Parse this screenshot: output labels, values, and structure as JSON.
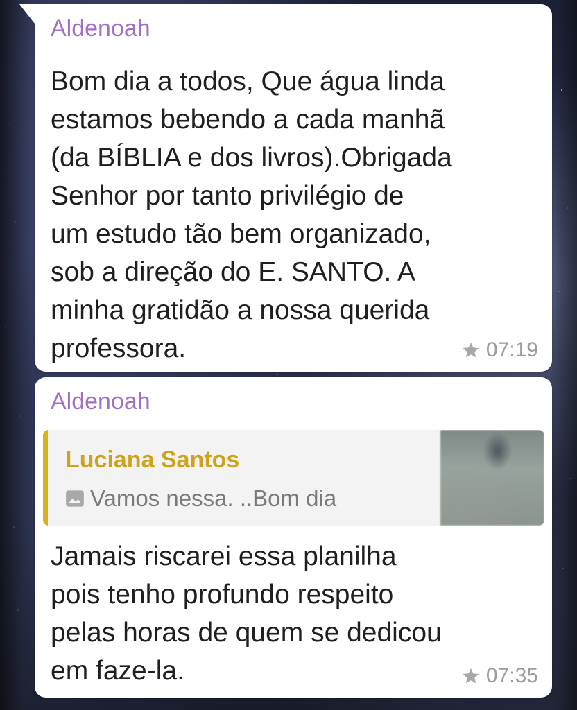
{
  "messages": [
    {
      "sender": "Aldenoah",
      "text": "Bom dia a todos, Que água linda\nestamos bebendo a cada manhã\n(da BÍBLIA e dos livros).Obrigada\nSenhor por tanto privilégio de\num estudo tão bem organizado,\nsob a direção  do E. SANTO. A\nminha gratidão a nossa querida\nprofessora.",
      "time": "07:19",
      "starred": true
    },
    {
      "sender": "Aldenoah",
      "reply": {
        "author": "Luciana Santos",
        "preview": "Vamos nessa. ..Bom dia",
        "type_icon": "image-icon"
      },
      "text": "Jamais riscarei essa planilha\npois tenho profundo respeito\npelas horas de quem se dedicou\nem faze-la.",
      "time": "07:35",
      "starred": true
    }
  ],
  "colors": {
    "sender_name": "#a36fc2",
    "reply_author": "#cfa21c",
    "reply_bar": "#d9b01e",
    "meta": "#9b9b9b",
    "bubble": "#ffffff"
  },
  "icons": {
    "star": "star-icon",
    "image": "image-icon"
  }
}
